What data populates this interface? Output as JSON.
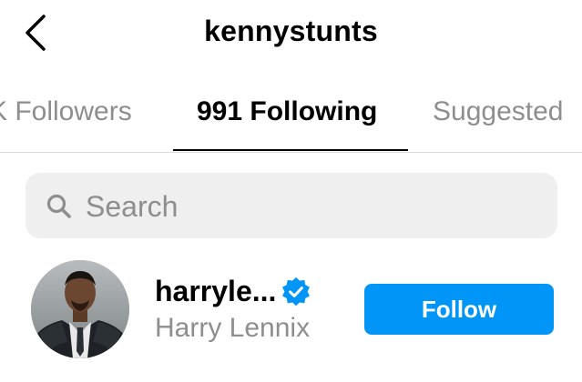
{
  "header": {
    "title": "kennystunts",
    "back_icon": "chevron-left-icon"
  },
  "tabs": [
    {
      "label": "K Followers",
      "active": false
    },
    {
      "label": "991 Following",
      "active": true
    },
    {
      "label": "Suggested",
      "active": false
    }
  ],
  "search": {
    "placeholder": "Search",
    "value": "",
    "icon": "search-icon"
  },
  "accounts": [
    {
      "username": "harryle...",
      "full_name": "Harry Lennix",
      "verified": true,
      "button_label": "Follow"
    }
  ],
  "colors": {
    "accent": "#0095f6",
    "muted_text": "#8e8e8e",
    "search_bg": "#efefef",
    "divider": "#dbdbdb"
  }
}
